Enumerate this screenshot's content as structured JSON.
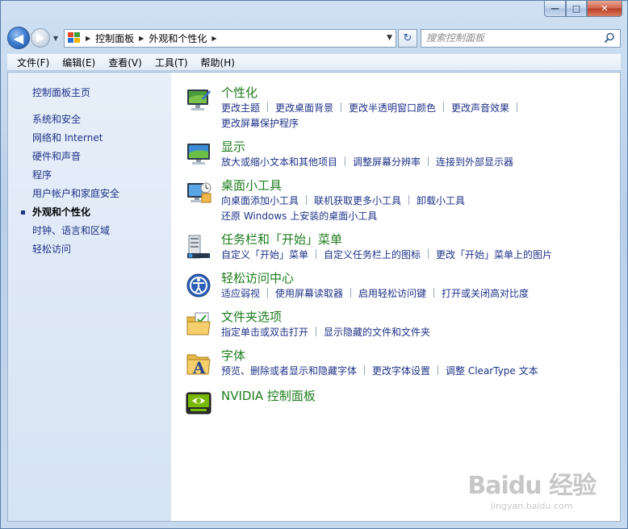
{
  "window": {
    "caption": {
      "minimize": "—",
      "maximize": "□",
      "close": "✕"
    }
  },
  "nav": {
    "back_glyph": "◀",
    "forward_glyph": "▶",
    "recent_glyph": "▼",
    "breadcrumbs": [
      "控制面板",
      "外观和个性化"
    ],
    "breadcrumb_sep": "▶",
    "address_drop": "▼",
    "refresh_glyph": "↻",
    "search_placeholder": "搜索控制面板"
  },
  "menubar": [
    "文件(F)",
    "编辑(E)",
    "查看(V)",
    "工具(T)",
    "帮助(H)"
  ],
  "sidebar": {
    "home": "控制面板主页",
    "items": [
      "系统和安全",
      "网络和 Internet",
      "硬件和声音",
      "程序",
      "用户帐户和家庭安全",
      "外观和个性化",
      "时钟、语言和区域",
      "轻松访问"
    ],
    "active_index": 5
  },
  "categories": [
    {
      "title": "个性化",
      "icon": "personalization-icon",
      "links": [
        [
          "更改主题",
          "更改桌面背景",
          "更改半透明窗口颜色",
          "更改声音效果"
        ],
        [
          "更改屏幕保护程序"
        ]
      ]
    },
    {
      "title": "显示",
      "icon": "display-icon",
      "links": [
        [
          "放大或缩小文本和其他项目",
          "调整屏幕分辨率",
          "连接到外部显示器"
        ]
      ]
    },
    {
      "title": "桌面小工具",
      "icon": "gadgets-icon",
      "links": [
        [
          "向桌面添加小工具",
          "联机获取更多小工具",
          "卸载小工具"
        ],
        [
          "还原 Windows 上安装的桌面小工具"
        ]
      ]
    },
    {
      "title": "任务栏和「开始」菜单",
      "icon": "taskbar-icon",
      "links": [
        [
          "自定义「开始」菜单",
          "自定义任务栏上的图标",
          "更改「开始」菜单上的图片"
        ]
      ]
    },
    {
      "title": "轻松访问中心",
      "icon": "ease-of-access-icon",
      "links": [
        [
          "适应弱视",
          "使用屏幕读取器",
          "启用轻松访问键",
          "打开或关闭高对比度"
        ]
      ]
    },
    {
      "title": "文件夹选项",
      "icon": "folder-options-icon",
      "links": [
        [
          "指定单击或双击打开",
          "显示隐藏的文件和文件夹"
        ]
      ]
    },
    {
      "title": "字体",
      "icon": "fonts-icon",
      "links": [
        [
          "预览、删除或者显示和隐藏字体",
          "更改字体设置",
          "调整 ClearType 文本"
        ]
      ]
    },
    {
      "title": "NVIDIA 控制面板",
      "icon": "nvidia-icon",
      "links": []
    }
  ],
  "watermark": {
    "logo": "Baidu 经验",
    "url": "jingyan.baidu.com"
  },
  "colors": {
    "link": "#1e3287",
    "category_title": "#1e7c1e",
    "sidebar_top": "#e7eff9",
    "sidebar_bottom": "#d6e3f3"
  }
}
